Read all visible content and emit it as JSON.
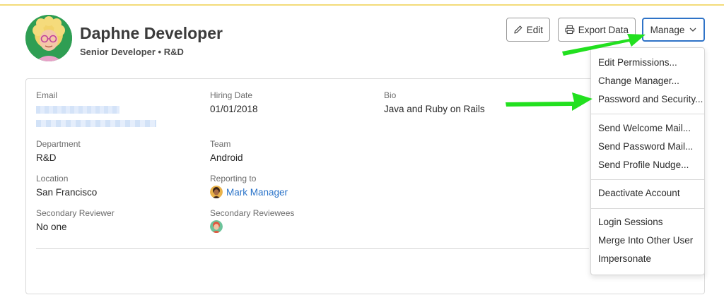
{
  "profile": {
    "name": "Daphne Developer",
    "subtitle": "Senior Developer • R&D"
  },
  "actions": {
    "edit_label": "Edit",
    "export_label": "Export Data",
    "manage_label": "Manage"
  },
  "details": {
    "email_label": "Email",
    "hiring_label": "Hiring Date",
    "hiring_value": "01/01/2018",
    "bio_label": "Bio",
    "bio_value": "Java and Ruby on Rails",
    "department_label": "Department",
    "department_value": "R&D",
    "team_label": "Team",
    "team_value": "Android",
    "location_label": "Location",
    "location_value": "San Francisco",
    "reporting_label": "Reporting to",
    "reporting_value": "Mark Manager",
    "sec_reviewer_label": "Secondary Reviewer",
    "sec_reviewer_value": "No one",
    "sec_reviewees_label": "Secondary Reviewees"
  },
  "menu": {
    "items": [
      "Edit Permissions...",
      "Change Manager...",
      "Password and Security...",
      "Send Welcome Mail...",
      "Send Password Mail...",
      "Send Profile Nudge...",
      "Deactivate Account",
      "Login Sessions",
      "Merge Into Other User",
      "Impersonate"
    ]
  },
  "colors": {
    "accent_blue": "#2f73c7",
    "link_blue": "#2a73c9",
    "annotation_green": "#22e01f",
    "top_rule": "#f3dc7a"
  },
  "icons": {
    "edit": "pencil-icon",
    "export": "printer-icon",
    "manage": "chevron-down-icon"
  }
}
